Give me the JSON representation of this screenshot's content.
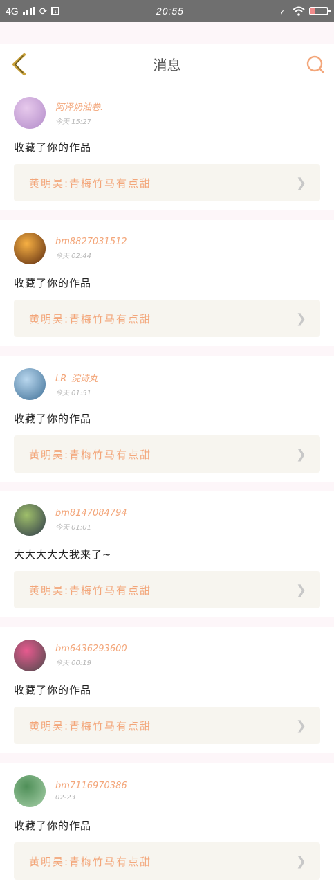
{
  "status_bar": {
    "network": "4G",
    "time": "20:55",
    "icons": [
      "signal-icon",
      "sync-icon",
      "download-icon",
      "bluetooth-icon",
      "wifi-icon",
      "battery-icon"
    ],
    "battery_level": 0.3
  },
  "header": {
    "title": "消息",
    "back_icon": "chevron-left-icon",
    "search_icon": "search-icon",
    "accent": "#c9a13a",
    "search_color": "#f3a67a"
  },
  "messages": [
    {
      "name": "阿泽奶油卷.",
      "time": "今天 15:27",
      "text": "收藏了你的作品",
      "ref": "黄明昊:青梅竹马有点甜"
    },
    {
      "name": "bm8827031512",
      "time": "今天 02:44",
      "text": "收藏了你的作品",
      "ref": "黄明昊:青梅竹马有点甜"
    },
    {
      "name": "LR_浣诗丸",
      "time": "今天 01:51",
      "text": "收藏了你的作品",
      "ref": "黄明昊:青梅竹马有点甜"
    },
    {
      "name": "bm8147084794",
      "time": "今天 01:01",
      "text": "大大大大大我来了~",
      "ref": "黄明昊:青梅竹马有点甜"
    },
    {
      "name": "bm6436293600",
      "time": "今天 00:19",
      "text": "收藏了你的作品",
      "ref": "黄明昊:青梅竹马有点甜"
    },
    {
      "name": "bm7116970386",
      "time": "02-23",
      "text": "收藏了你的作品",
      "ref": "黄明昊:青梅竹马有点甜"
    }
  ]
}
